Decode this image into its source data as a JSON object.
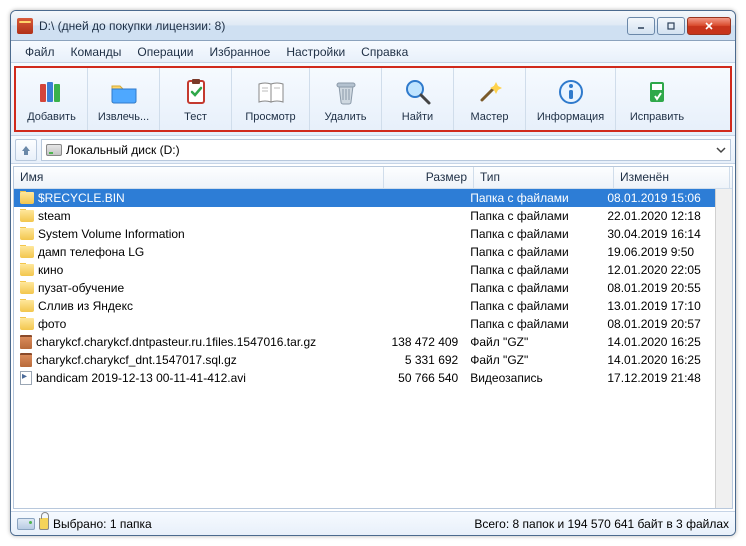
{
  "window": {
    "title": "D:\\ (дней до покупки лицензии: 8)"
  },
  "menu": {
    "items": [
      "Файл",
      "Команды",
      "Операции",
      "Избранное",
      "Настройки",
      "Справка"
    ]
  },
  "toolbar": {
    "buttons": [
      {
        "id": "add",
        "label": "Добавить"
      },
      {
        "id": "extract",
        "label": "Извлечь..."
      },
      {
        "id": "test",
        "label": "Тест"
      },
      {
        "id": "view",
        "label": "Просмотр"
      },
      {
        "id": "delete",
        "label": "Удалить"
      },
      {
        "id": "find",
        "label": "Найти"
      },
      {
        "id": "wizard",
        "label": "Мастер"
      },
      {
        "id": "info",
        "label": "Информация"
      },
      {
        "id": "repair",
        "label": "Исправить"
      }
    ]
  },
  "location": {
    "path_label": "Локальный диск (D:)"
  },
  "columns": {
    "name": "Имя",
    "size": "Размер",
    "type": "Тип",
    "modified": "Изменён"
  },
  "files": [
    {
      "name": "$RECYCLE.BIN",
      "size": "",
      "type": "Папка с файлами",
      "modified": "08.01.2019 15:06",
      "icon": "folder",
      "selected": true
    },
    {
      "name": "steam",
      "size": "",
      "type": "Папка с файлами",
      "modified": "22.01.2020 12:18",
      "icon": "folder"
    },
    {
      "name": "System Volume Information",
      "size": "",
      "type": "Папка с файлами",
      "modified": "30.04.2019 16:14",
      "icon": "folder"
    },
    {
      "name": "дамп телефона LG",
      "size": "",
      "type": "Папка с файлами",
      "modified": "19.06.2019 9:50",
      "icon": "folder"
    },
    {
      "name": "кино",
      "size": "",
      "type": "Папка с файлами",
      "modified": "12.01.2020 22:05",
      "icon": "folder"
    },
    {
      "name": "пузат-обучение",
      "size": "",
      "type": "Папка с файлами",
      "modified": "08.01.2019 20:55",
      "icon": "folder"
    },
    {
      "name": "Сллив из Яндекс",
      "size": "",
      "type": "Папка с файлами",
      "modified": "13.01.2019 17:10",
      "icon": "folder"
    },
    {
      "name": "фото",
      "size": "",
      "type": "Папка с файлами",
      "modified": "08.01.2019 20:57",
      "icon": "folder"
    },
    {
      "name": "charykcf.charykcf.dntpasteur.ru.1files.1547016.tar.gz",
      "size": "138 472 409",
      "type": "Файл \"GZ\"",
      "modified": "14.01.2020 16:25",
      "icon": "archive"
    },
    {
      "name": "charykcf.charykcf_dnt.1547017.sql.gz",
      "size": "5 331 692",
      "type": "Файл \"GZ\"",
      "modified": "14.01.2020 16:25",
      "icon": "archive"
    },
    {
      "name": "bandicam 2019-12-13 00-11-41-412.avi",
      "size": "50 766 540",
      "type": "Видеозапись",
      "modified": "17.12.2019 21:48",
      "icon": "video"
    }
  ],
  "status": {
    "selection": "Выбрано: 1 папка",
    "totals": "Всего: 8 папок и 194 570 641 байт в 3 файлах"
  }
}
